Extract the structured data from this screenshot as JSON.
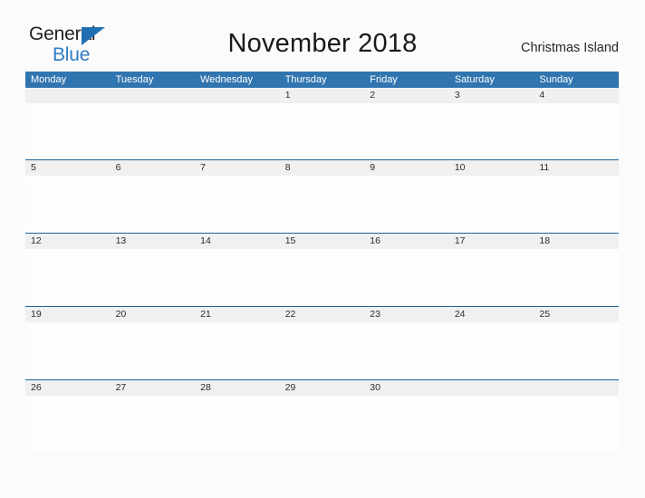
{
  "brand": {
    "name_top": "General",
    "name_bottom": "Blue",
    "flag_icon": "triangle-flag-icon",
    "color_blue": "#2e7cc4"
  },
  "header": {
    "title": "November 2018",
    "locale": "Christmas Island"
  },
  "calendar": {
    "month": "November",
    "year": "2018",
    "accent_color": "#3175b0",
    "separator_color": "#1f6296",
    "date_band_color": "#f0f0f0",
    "weekday_headers": [
      "Monday",
      "Tuesday",
      "Wednesday",
      "Thursday",
      "Friday",
      "Saturday",
      "Sunday"
    ],
    "weeks": [
      [
        "",
        "",
        "",
        "1",
        "2",
        "3",
        "4"
      ],
      [
        "5",
        "6",
        "7",
        "8",
        "9",
        "10",
        "11"
      ],
      [
        "12",
        "13",
        "14",
        "15",
        "16",
        "17",
        "18"
      ],
      [
        "19",
        "20",
        "21",
        "22",
        "23",
        "24",
        "25"
      ],
      [
        "26",
        "27",
        "28",
        "29",
        "30",
        "",
        ""
      ]
    ]
  }
}
